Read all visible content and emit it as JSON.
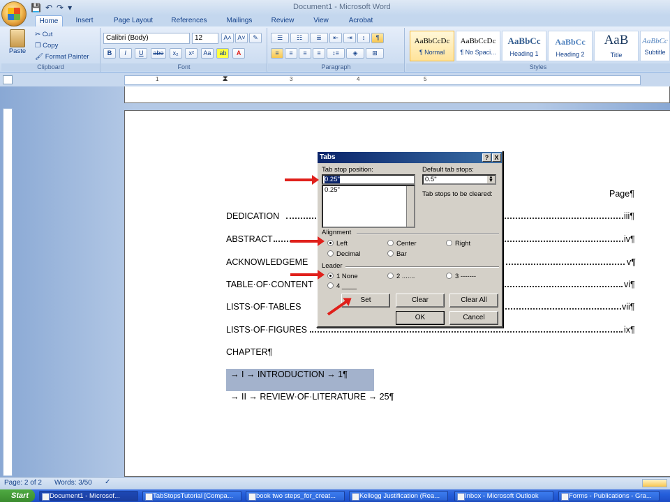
{
  "window": {
    "title": "Document1 - Microsoft Word"
  },
  "qat": {
    "save": "💾",
    "undo": "↶",
    "redo": "↷",
    "more": "▾"
  },
  "tabs": [
    "Home",
    "Insert",
    "Page Layout",
    "References",
    "Mailings",
    "Review",
    "View",
    "Acrobat"
  ],
  "clipboard": {
    "paste": "Paste",
    "cut": "Cut",
    "copy": "Copy",
    "format_painter": "Format Painter",
    "label": "Clipboard"
  },
  "font": {
    "name": "Calibri (Body)",
    "size": "12",
    "label": "Font",
    "buttons": [
      "B",
      "I",
      "U",
      "abe",
      "x₂",
      "x²",
      "Aa",
      "ab",
      "A"
    ]
  },
  "paragraph": {
    "label": "Paragraph",
    "pilcrow": "¶"
  },
  "styles": {
    "label": "Styles",
    "items": [
      {
        "preview": "AaBbCcDc",
        "name": "¶ Normal"
      },
      {
        "preview": "AaBbCcDc",
        "name": "¶ No Spaci..."
      },
      {
        "preview": "AaBbCc",
        "name": "Heading 1"
      },
      {
        "preview": "AaBbCc",
        "name": "Heading 2"
      },
      {
        "preview": "AaB",
        "name": "Title"
      },
      {
        "preview": "AaBbCc",
        "name": "Subtitle"
      }
    ]
  },
  "ruler": {
    "marks": [
      "1",
      "2",
      "3",
      "4",
      "5"
    ]
  },
  "document": {
    "page_header": "Page¶",
    "toc": [
      {
        "entry": "DEDICATION",
        "page": "iii¶"
      },
      {
        "entry": "ABSTRACT",
        "page": "iv¶"
      },
      {
        "entry": "ACKNOWLEDGEME",
        "page": "v¶"
      },
      {
        "entry": "TABLE·OF·CONTENT",
        "page": "vi¶"
      },
      {
        "entry": "LISTS·OF·TABLES",
        "page": "vii¶"
      },
      {
        "entry": "LISTS·OF·FIGURES",
        "page": "ix¶"
      }
    ],
    "chapter": "CHAPTER¶",
    "ch1": "→   I →   INTRODUCTION    →      1¶",
    "ch2": "→   II →  REVIEW·OF·LITERATURE   →    25¶"
  },
  "dialog": {
    "title": "Tabs",
    "help": "?",
    "close": "X",
    "tab_stop_label": "Tab stop position:",
    "tab_stop_value": "0.25\"",
    "tab_list": [
      "0.25\""
    ],
    "default_label": "Default tab stops:",
    "default_value": "0.5\"",
    "cleared_label": "Tab stops to be cleared:",
    "alignment_label": "Alignment",
    "alignment": [
      {
        "label": "Left",
        "checked": true
      },
      {
        "label": "Center"
      },
      {
        "label": "Right"
      },
      {
        "label": "Decimal"
      },
      {
        "label": "Bar"
      }
    ],
    "leader_label": "Leader",
    "leader": [
      {
        "label": "1 None",
        "checked": true
      },
      {
        "label": "2 ......."
      },
      {
        "label": "3 -------"
      },
      {
        "label": "4 ____"
      }
    ],
    "set": "Set",
    "clear": "Clear",
    "clear_all": "Clear All",
    "ok": "OK",
    "cancel": "Cancel"
  },
  "status": {
    "page": "Page: 2 of 2",
    "words": "Words: 3/50"
  },
  "taskbar": {
    "start": "Start",
    "items": [
      "Document1 - Microsof...",
      "TabStopsTutorial [Compa...",
      "book two steps_for_creat...",
      "Kellogg Justification (Rea...",
      "Inbox - Microsoft Outlook",
      "Forms - Publications - Gra..."
    ]
  }
}
